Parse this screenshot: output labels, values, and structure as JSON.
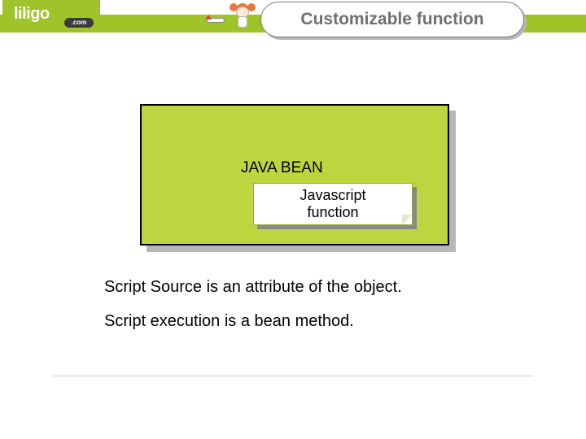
{
  "header": {
    "logo_text": "liligo",
    "logo_suffix": ".com",
    "title": "Customizable function"
  },
  "diagram": {
    "bean_label": "JAVA BEAN",
    "js_label": "Javascript\nfunction"
  },
  "body": {
    "line1": "Script Source is an attribute of the object.",
    "line2": "Script execution is a bean method."
  }
}
